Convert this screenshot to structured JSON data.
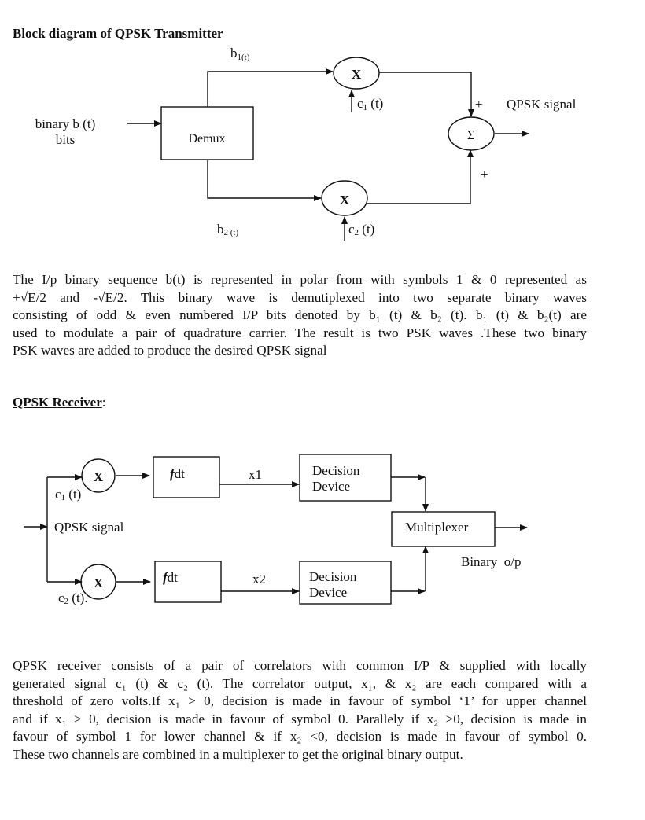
{
  "transmitter": {
    "title": "Block diagram of QPSK Transmitter",
    "input_label_line1": "binary b (t)",
    "input_label_line2": "bits",
    "demux_label": "Demux",
    "b1_label": "b",
    "b1_sub": "1(t)",
    "b2_label": "b",
    "b2_sub": "2 (t)",
    "mult_symbol": "X",
    "c1_label": "c",
    "c1_sub": "1",
    "c1_suffix": " (t)",
    "c2_label": "c",
    "c2_sub": "2",
    "c2_suffix": " (t)",
    "sum_symbol": "Σ",
    "plus_top": "+",
    "plus_bottom": "+",
    "output_label": "QPSK signal"
  },
  "transmitter_text": {
    "lines": [
      "The I/p binary sequence b(t) is represented in polar from with symbols 1 & 0 represented as",
      "+√E/2 and -√E/2. This binary wave is demutiplexed  into two separate binary waves",
      "consisting of odd  & even numbered  I/P bits denoted by  b₁ (t) & b₂ (t). b₁ (t) & b₂(t) are",
      "used to modulate a pair of quadrature carrier. The result is two PSK waves .These two binary",
      "PSK waves are added to produce the desired QPSK signal"
    ]
  },
  "receiver": {
    "title": "QPSK Receiver",
    "title_suffix": ":",
    "input_label": "QPSK signal",
    "mult_symbol": "X",
    "c1_label": "c",
    "c1_sub": "1",
    "c1_suffix": " (t)",
    "c2_label": "c",
    "c2_sub": "2",
    "c2_suffix": " (t).",
    "integrator_f": "f",
    "integrator_dt": "dt",
    "x1_label": "x1",
    "x2_label": "x2",
    "decision_line1": "Decision",
    "decision_line2": "Device",
    "mux_label": "Multiplexer",
    "output_label": "Binary  o/p"
  },
  "receiver_text": {
    "lines": [
      "QPSK receiver consists of a pair of correlators with common I/P & supplied with  locally",
      "generated signal c₁ (t) & c₂ (t). The correlator output, x₁, & x₂ are each compared with a",
      "threshold of zero volts.If x₁ > 0, decision is made in favour of symbol ‘1’ for upper channel",
      "and if x₁ > 0, decision is made in favour of symbol 0. Parallely if x₂ >0, decision is made in",
      "favour of symbol 1 for lower channel & if x₂ <0, decision is made in favour of symbol 0.",
      "These two channels are combined in a multiplexer to get the original binary output."
    ]
  }
}
